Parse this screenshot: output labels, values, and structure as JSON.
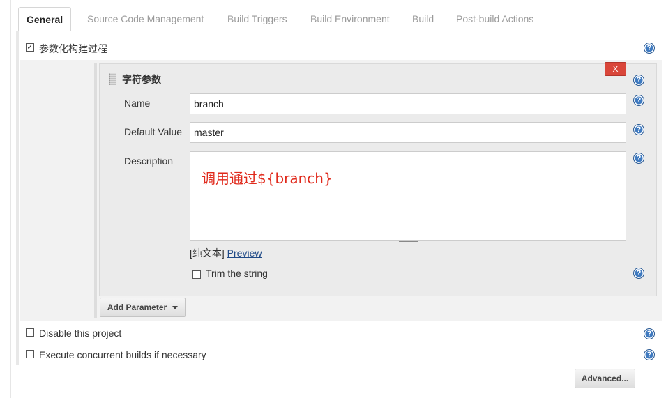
{
  "tabs": [
    {
      "label": "General"
    },
    {
      "label": "Source Code Management"
    },
    {
      "label": "Build Triggers"
    },
    {
      "label": "Build Environment"
    },
    {
      "label": "Build"
    },
    {
      "label": "Post-build Actions"
    }
  ],
  "parameterized": {
    "label": "参数化构建过程",
    "checked": true
  },
  "parameter": {
    "title": "字符参数",
    "delete_label": "X",
    "name_label": "Name",
    "name_value": "branch",
    "default_label": "Default Value",
    "default_value": "master",
    "description_label": "Description",
    "description_value": "调用通过${branch}",
    "plain_text": "[纯文本]",
    "preview_label": "Preview",
    "trim_label": "Trim the string",
    "trim_checked": false
  },
  "add_parameter_label": "Add Parameter",
  "options": [
    {
      "label": "Disable this project",
      "checked": false
    },
    {
      "label": "Execute concurrent builds if necessary",
      "checked": false
    }
  ],
  "advanced_label": "Advanced...",
  "help_glyph": "?",
  "check_glyph": "✓",
  "colors": {
    "accent": "#3f7ac0",
    "delete": "#d9463a",
    "description_text": "#e02a1c"
  }
}
